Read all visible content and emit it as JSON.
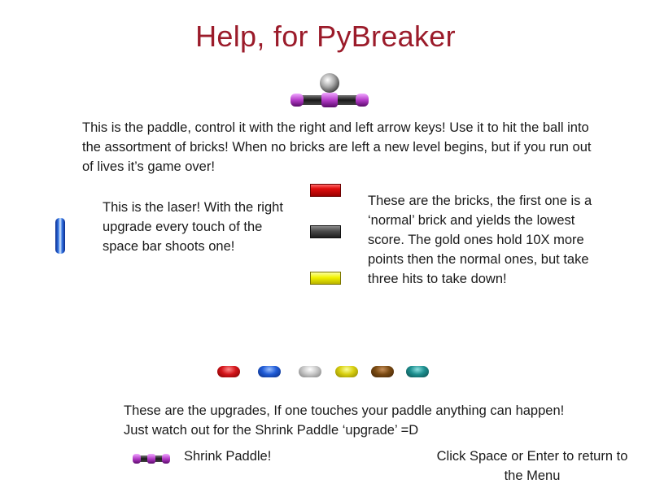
{
  "title": "Help, for PyBreaker",
  "paragraphs": {
    "paddle": "This is the paddle, control it with the right and left arrow keys! Use it to hit the ball into the assortment of bricks!  When no bricks are left a new level begins, but if you run out of lives it’s game over!",
    "laser": "This is the laser! With the right upgrade every touch of the space bar shoots one!",
    "bricks": "These are the bricks, the first one is a ‘normal’ brick and yields the lowest score.  The gold ones hold 10X more points then the normal ones, but take three hits to take down!",
    "upgrades": "These are the upgrades, If one touches your paddle anything can happen! Just watch out for the Shrink Paddle ‘upgrade’ =D",
    "shrink": "Shrink Paddle!",
    "return": "Click Space or Enter to return to the Menu"
  },
  "upgrades": [
    {
      "color_main": "#d3141a",
      "color_light": "#ff8a8a",
      "color_dark": "#7a0000"
    },
    {
      "color_main": "#1f5bd6",
      "color_light": "#9cc0ff",
      "color_dark": "#0a2a7a"
    },
    {
      "color_main": "#c8c8c8",
      "color_light": "#ffffff",
      "color_dark": "#7a7a7a"
    },
    {
      "color_main": "#d8cf10",
      "color_light": "#fbff9a",
      "color_dark": "#8a8200"
    },
    {
      "color_main": "#7a4a12",
      "color_light": "#c8905a",
      "color_dark": "#3e2206"
    },
    {
      "color_main": "#1d8f8f",
      "color_light": "#8ce0e0",
      "color_dark": "#0b4a4a"
    }
  ],
  "colors": {
    "title": "#9b1b2a",
    "paddle_body": "#222222",
    "paddle_ends": "#b43cc8",
    "ball": "#a8a8a8"
  }
}
